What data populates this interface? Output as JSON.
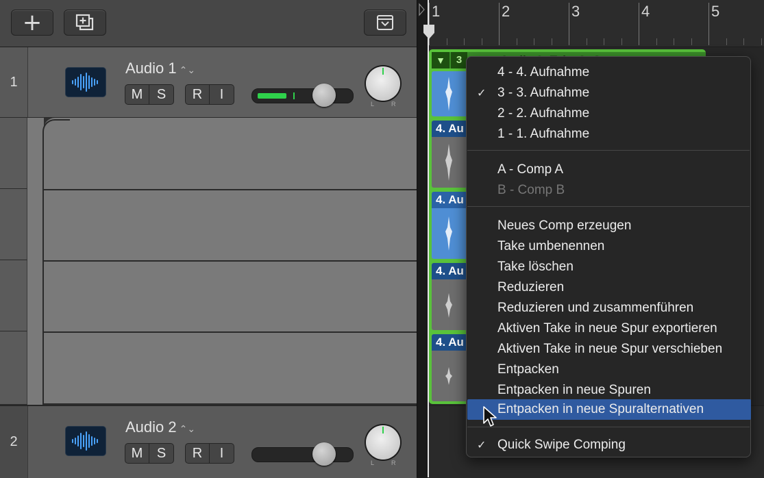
{
  "toolbar": {
    "add_label": "+",
    "duplicate_icon": "duplicate-track-icon",
    "collapse_icon": "collapse-icon"
  },
  "tracks": [
    {
      "number": "1",
      "name": "Audio 1",
      "mute": "M",
      "solo": "S",
      "record": "R",
      "input": "I",
      "pan_l": "L",
      "pan_r": "R"
    },
    {
      "number": "2",
      "name": "Audio 2",
      "mute": "M",
      "solo": "S",
      "record": "R",
      "input": "I",
      "pan_l": "L",
      "pan_r": "R"
    }
  ],
  "ruler": {
    "bars": [
      "1",
      "2",
      "3",
      "4",
      "5"
    ]
  },
  "take_folder": {
    "active_take_number": "3",
    "header_name": "Audio 3: Take 3: Comp"
  },
  "takes": [
    {
      "label": "4. Au"
    },
    {
      "label": "4. Au"
    },
    {
      "label": "4. Au"
    },
    {
      "label": "4. Au"
    }
  ],
  "menu": {
    "takes": [
      {
        "label": "4 - 4. Aufnahme",
        "checked": false
      },
      {
        "label": "3 - 3. Aufnahme",
        "checked": true
      },
      {
        "label": "2 - 2. Aufnahme",
        "checked": false
      },
      {
        "label": "1 - 1. Aufnahme",
        "checked": false
      }
    ],
    "comps": [
      {
        "label": "A - Comp A",
        "enabled": true
      },
      {
        "label": "B - Comp B",
        "enabled": false
      }
    ],
    "actions": [
      "Neues Comp erzeugen",
      "Take umbenennen",
      "Take löschen",
      "Reduzieren",
      "Reduzieren und zusammenführen",
      "Aktiven Take in neue Spur exportieren",
      "Aktiven Take in neue Spur verschieben",
      "Entpacken",
      "Entpacken in neue Spuren",
      "Entpacken in neue Spuralternativen"
    ],
    "highlighted": "Entpacken in neue Spuralternativen",
    "quick_swipe": {
      "label": "Quick Swipe Comping",
      "checked": true
    }
  },
  "colors": {
    "take_folder_green": "#59c23b",
    "active_take_blue": "#4f8ed4",
    "menu_highlight": "#2f5aa0",
    "level_meter": "#2fd14b"
  }
}
